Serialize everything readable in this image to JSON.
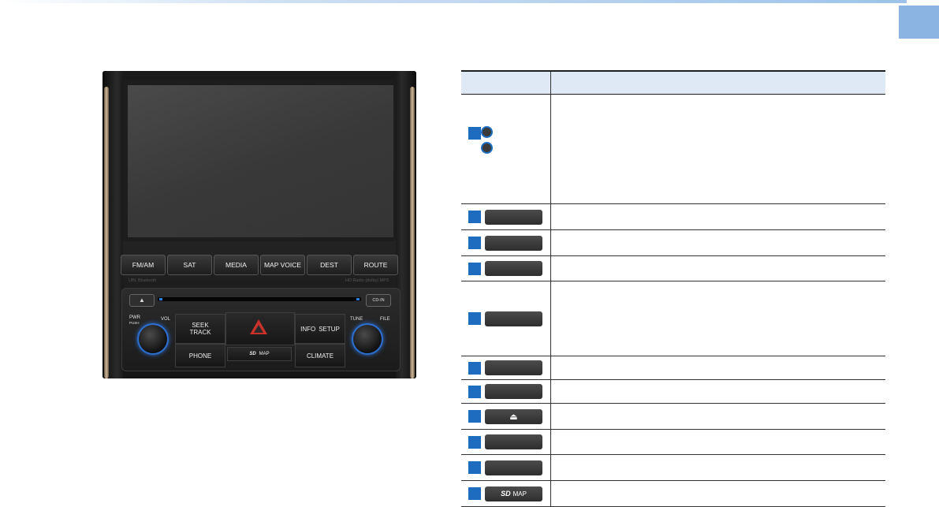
{
  "unit": {
    "buttons": [
      "FM/AM",
      "SAT",
      "MEDIA",
      "MAP VOICE",
      "DEST",
      "ROUTE"
    ],
    "brand_left": "UBL  Bluetooth",
    "brand_right": "HD Radio  (dolby)  MP3",
    "eject": "▲",
    "cd_in": "CD-IN",
    "pwr": "PWR",
    "push": "PUSH",
    "vol": "VOL",
    "seek": "SEEK",
    "track": "TRACK",
    "info": "INFO",
    "setup": "SETUP",
    "tune": "TUNE",
    "file": "FILE",
    "phone": "PHONE",
    "sd": "SD",
    "map": "MAP",
    "climate": "CLIMATE"
  },
  "table": {
    "header": [
      "",
      ""
    ],
    "rows": [
      {
        "type": "knobs",
        "label": ""
      },
      {
        "type": "pill",
        "label": ""
      },
      {
        "type": "pill",
        "label": ""
      },
      {
        "type": "pill",
        "label": ""
      },
      {
        "type": "pill",
        "label": ""
      },
      {
        "type": "pill",
        "label": ""
      },
      {
        "type": "pill",
        "label": ""
      },
      {
        "type": "eject",
        "label": "⏏"
      },
      {
        "type": "pill",
        "label": ""
      },
      {
        "type": "pill",
        "label": ""
      },
      {
        "type": "sdmap",
        "sd": "SD",
        "map": "MAP"
      }
    ]
  }
}
